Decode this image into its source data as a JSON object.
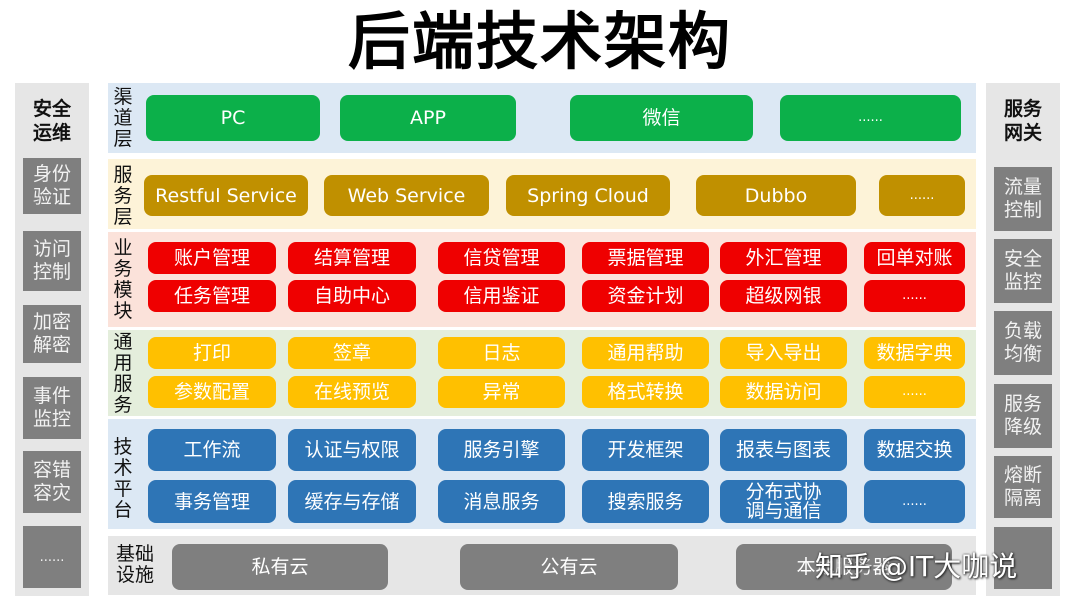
{
  "title": "后端技术架构",
  "colors": {
    "channel_bg": "#dce8f4",
    "channel_box": "#0cb04a",
    "service_bg": "#fdf3d8",
    "service_box": "#c09000",
    "business_bg": "#fbe2da",
    "business_box": "#ef0000",
    "common_bg": "#e4eedc",
    "common_box": "#ffc000",
    "tech_bg": "#dce8f4",
    "tech_box": "#2e75b6",
    "infra_bg": "#e6e6e6",
    "infra_box": "#7f7f7f",
    "side_box": "#7f7f7f"
  },
  "left_sidebar": {
    "header": "安全\n运维",
    "items": [
      "身份\n验证",
      "访问\n控制",
      "加密\n解密",
      "事件\n监控",
      "容错\n容灾",
      "......"
    ]
  },
  "right_sidebar": {
    "header": "服务\n网关",
    "items": [
      "流量\n控制",
      "安全\n监控",
      "负载\n均衡",
      "服务\n降级",
      "熔断\n隔离",
      ""
    ]
  },
  "layers": {
    "channel": {
      "label": "渠道层",
      "items": [
        "PC",
        "APP",
        "微信",
        "......"
      ]
    },
    "service": {
      "label": "服务层",
      "items": [
        "Restful Service",
        "Web Service",
        "Spring Cloud",
        "Dubbo",
        "......"
      ]
    },
    "business": {
      "label": "业务模块",
      "row1": [
        "账户管理",
        "结算管理",
        "信贷管理",
        "票据管理",
        "外汇管理",
        "回单对账"
      ],
      "row2": [
        "任务管理",
        "自助中心",
        "信用鉴证",
        "资金计划",
        "超级网银",
        "......"
      ]
    },
    "common": {
      "label": "通用服务",
      "row1": [
        "打印",
        "签章",
        "日志",
        "通用帮助",
        "导入导出",
        "数据字典"
      ],
      "row2": [
        "参数配置",
        "在线预览",
        "异常",
        "格式转换",
        "数据访问",
        "......"
      ]
    },
    "tech": {
      "label": "技术平台",
      "row1": [
        "工作流",
        "认证与权限",
        "服务引擎",
        "开发框架",
        "报表与图表",
        "数据交换"
      ],
      "row2": [
        "事务管理",
        "缓存与存储",
        "消息服务",
        "搜索服务",
        "分布式协\n调与通信",
        "......"
      ]
    },
    "infra": {
      "label": "基础\n设施",
      "items": [
        "私有云",
        "公有云",
        "本地服务器"
      ]
    }
  },
  "watermark": "知乎 @IT大咖说"
}
